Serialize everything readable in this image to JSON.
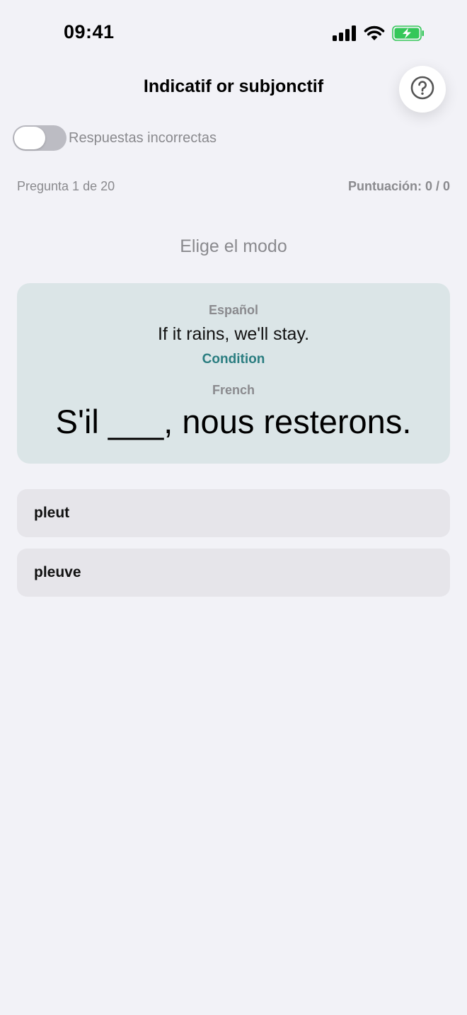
{
  "status_bar": {
    "time": "09:41"
  },
  "header": {
    "title": "Indicatif or subjonctif",
    "help_icon": "question-circle-icon"
  },
  "filter": {
    "toggle_on": false,
    "label": "Respuestas incorrectas"
  },
  "progress": {
    "question_text": "Pregunta 1 de 20",
    "score_text": "Puntuación: 0 / 0"
  },
  "instruction": "Elige el modo",
  "card": {
    "source_language": "Español",
    "source_sentence": "If it rains, we'll stay.",
    "clue": "Condition",
    "target_language": "French",
    "target_sentence": "S'il ___, nous resterons."
  },
  "options": [
    {
      "label": "pleut"
    },
    {
      "label": "pleuve"
    }
  ],
  "colors": {
    "background": "#f2f2f7",
    "card": "#dbe5e7",
    "accent": "#2a7d80",
    "option": "#e6e5ea",
    "battery": "#34c759"
  }
}
